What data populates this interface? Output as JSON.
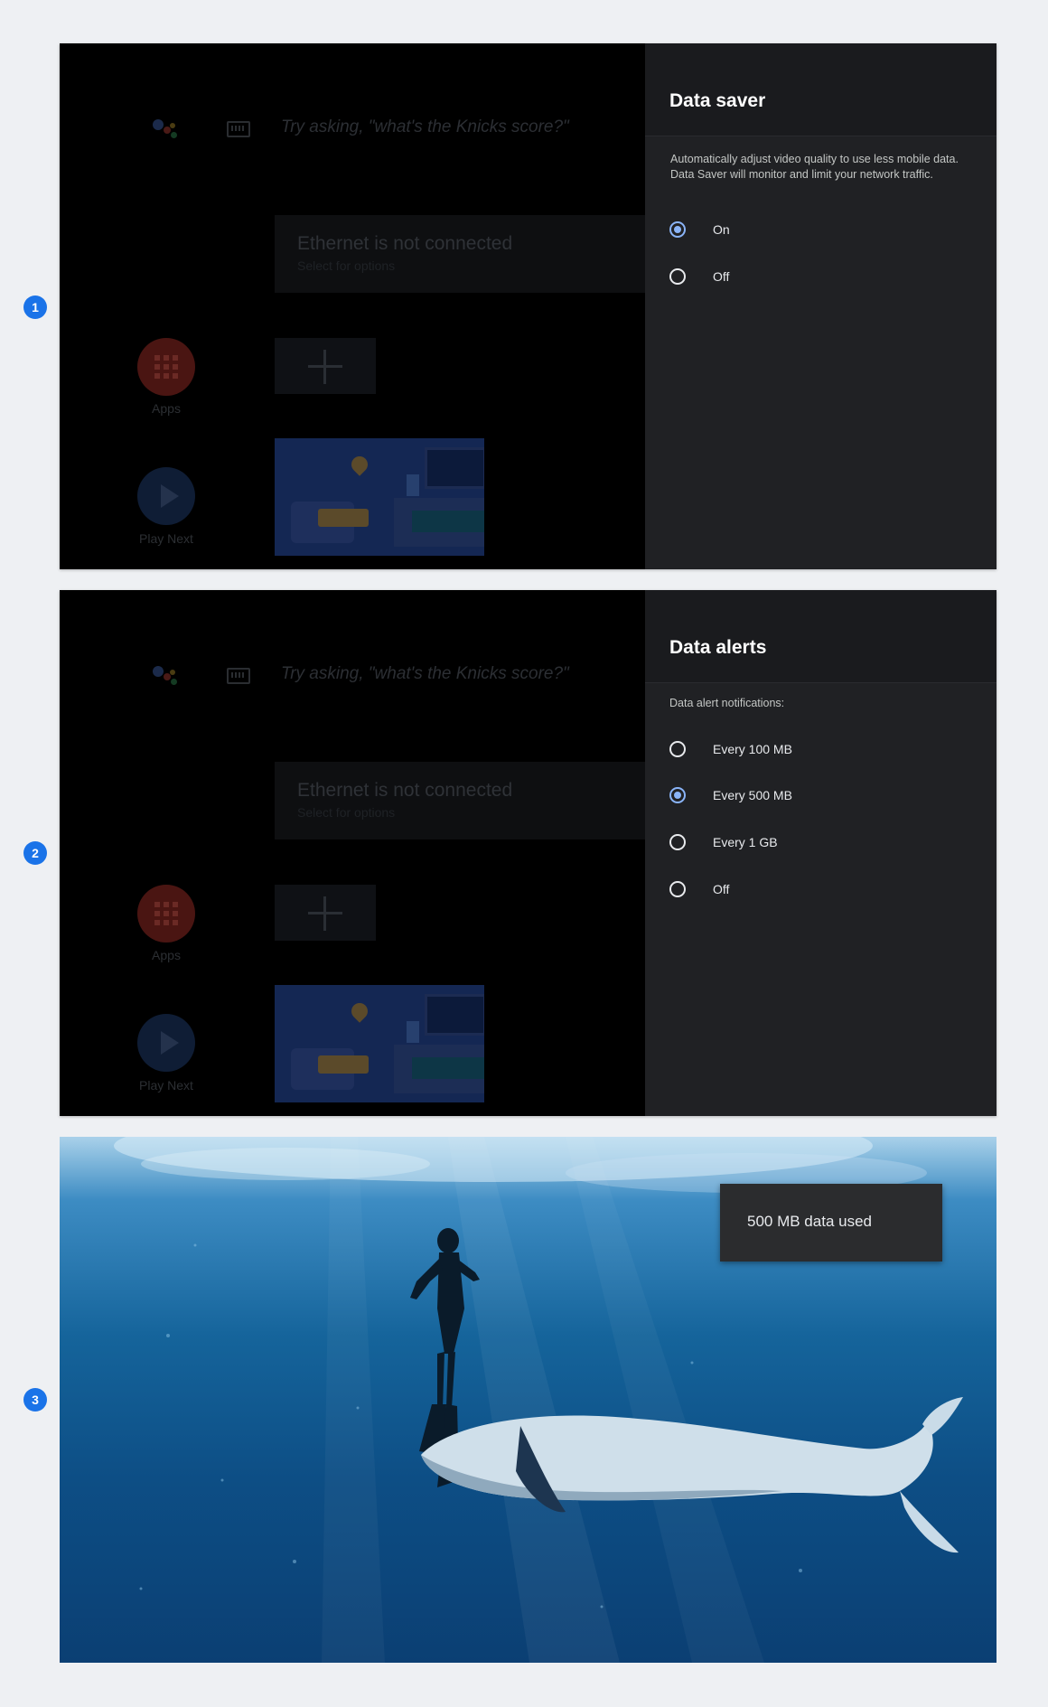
{
  "steps": [
    "1",
    "2",
    "3"
  ],
  "home": {
    "assistant_hint": "Try asking, \"what's the Knicks score?\"",
    "ethernet_title": "Ethernet is not connected",
    "ethernet_subtitle": "Select for options",
    "apps_label": "Apps",
    "play_next_label": "Play Next"
  },
  "data_saver": {
    "title": "Data saver",
    "description": "Automatically adjust video quality to use less mobile data. Data Saver will monitor and limit your network traffic.",
    "options": [
      {
        "label": "On",
        "selected": true
      },
      {
        "label": "Off",
        "selected": false
      }
    ]
  },
  "data_alerts": {
    "title": "Data alerts",
    "subtitle": "Data alert notifications:",
    "options": [
      {
        "label": "Every 100 MB",
        "selected": false
      },
      {
        "label": "Every 500 MB",
        "selected": true
      },
      {
        "label": "Every 1 GB",
        "selected": false
      },
      {
        "label": "Off",
        "selected": false
      }
    ]
  },
  "toast": {
    "message": "500 MB data used"
  },
  "colors": {
    "accent": "#8ab4f8",
    "badge": "#1a73e8",
    "panel_bg": "#202124"
  }
}
